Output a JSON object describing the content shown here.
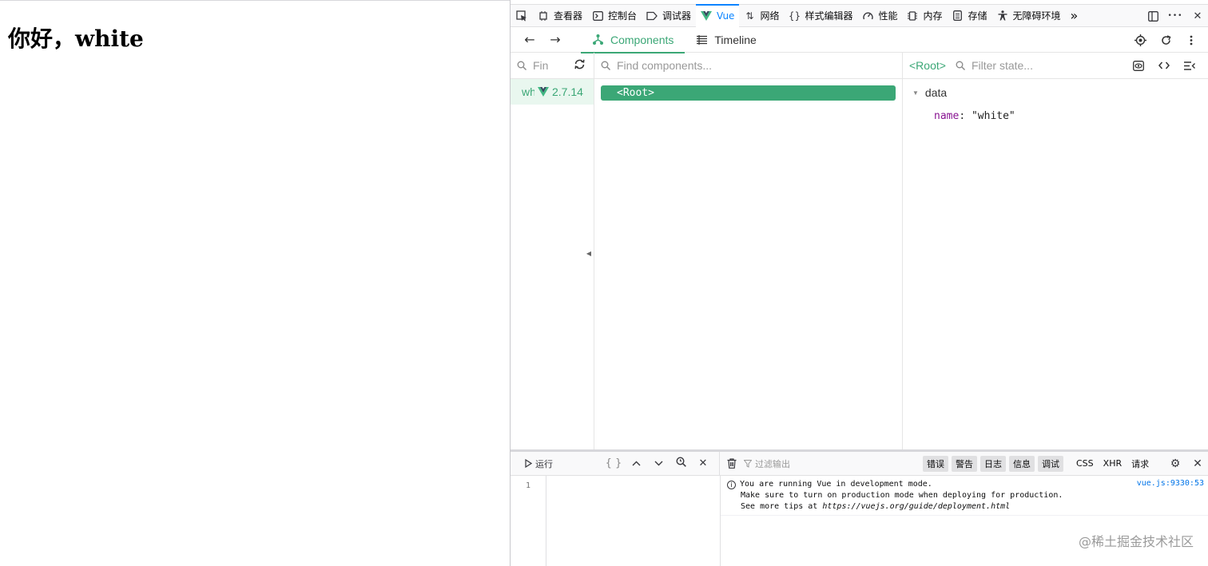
{
  "page": {
    "heading": "你好，white"
  },
  "toolbar": {
    "tabs": [
      {
        "label": "查看器",
        "icon": "inspector-icon"
      },
      {
        "label": "控制台",
        "icon": "console-icon"
      },
      {
        "label": "调试器",
        "icon": "debugger-icon"
      },
      {
        "label": "Vue",
        "icon": "vue-logo-icon"
      },
      {
        "label": "网络",
        "icon": "network-icon"
      },
      {
        "label": "样式编辑器",
        "icon": "style-editor-icon"
      },
      {
        "label": "性能",
        "icon": "performance-icon"
      },
      {
        "label": "内存",
        "icon": "memory-icon"
      },
      {
        "label": "存储",
        "icon": "storage-icon"
      },
      {
        "label": "无障碍环境",
        "icon": "accessibility-icon"
      }
    ],
    "active_tab": "Vue",
    "more": "»",
    "menu": "•••",
    "close": "✕"
  },
  "vue_bar": {
    "back": "←",
    "forward": "→",
    "tabs": [
      {
        "label": "Components"
      },
      {
        "label": "Timeline"
      }
    ]
  },
  "apps": {
    "search_placeholder": "Find apps...",
    "search_visible": "Fin",
    "items": [
      {
        "name": "wh",
        "version": "2.7.14"
      }
    ]
  },
  "tree": {
    "search_placeholder": "Find components...",
    "root": "<Root>"
  },
  "state": {
    "component": "<Root>",
    "filter_placeholder": "Filter state...",
    "section": "data",
    "props": [
      {
        "key": "name",
        "value": "\"white\""
      }
    ]
  },
  "console": {
    "run_label": "运行",
    "filter_placeholder": "过滤输出",
    "levels": [
      "错误",
      "警告",
      "日志",
      "信息",
      "调试"
    ],
    "types": [
      "CSS",
      "XHR",
      "请求"
    ],
    "gutter_line": "1",
    "message": {
      "line1": "You are running Vue in development mode.",
      "line2": "Make sure to turn on production mode when deploying for production.",
      "line3_prefix": "See more tips at ",
      "line3_link": "https://vuejs.org/guide/deployment.html",
      "source": "vue.js:9330:53"
    }
  },
  "watermark": "@稀土掘金技术社区",
  "colors": {
    "vue_green": "#3ba776",
    "firefox_blue": "#0a84ff"
  }
}
